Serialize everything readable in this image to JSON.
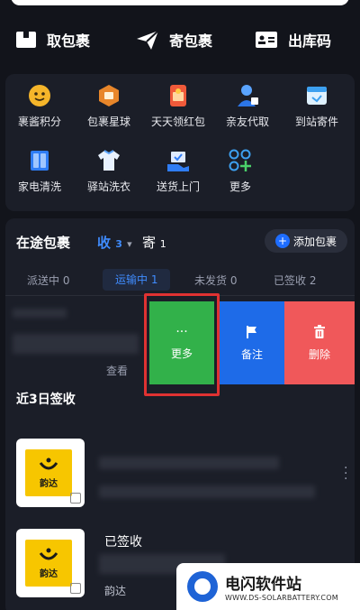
{
  "actions": [
    {
      "label": "取包裹",
      "icon": "package-box-icon"
    },
    {
      "label": "寄包裹",
      "icon": "paper-plane-icon"
    },
    {
      "label": "出库码",
      "icon": "id-card-icon"
    }
  ],
  "services": [
    {
      "label": "裹酱积分",
      "icon": "mascot-points-icon"
    },
    {
      "label": "包裹星球",
      "icon": "planet-package-icon"
    },
    {
      "label": "天天领红包",
      "icon": "red-packet-icon"
    },
    {
      "label": "亲友代取",
      "icon": "person-proxy-icon"
    },
    {
      "label": "到站寄件",
      "icon": "station-send-icon"
    },
    {
      "label": "家电清洗",
      "icon": "appliance-clean-icon"
    },
    {
      "label": "驿站洗衣",
      "icon": "shirt-laundry-icon"
    },
    {
      "label": "送货上门",
      "icon": "home-delivery-icon"
    },
    {
      "label": "更多",
      "icon": "more-grid-plus-icon"
    }
  ],
  "packages": {
    "title": "在途包裹",
    "receive_label": "收",
    "receive_count": "3",
    "send_label": "寄",
    "send_count": "1",
    "add_button": "添加包裹"
  },
  "sub_tabs": [
    {
      "label": "派送中",
      "count": "0"
    },
    {
      "label": "运输中",
      "count": "1"
    },
    {
      "label": "未发货",
      "count": "0"
    },
    {
      "label": "已签收",
      "count": "2"
    }
  ],
  "swipe_actions": {
    "more": "更多",
    "more_icon": "···",
    "note": "备注",
    "delete": "删除"
  },
  "partial_text": {
    "view": "查看"
  },
  "recent": {
    "title": "近3日签收",
    "items": [
      {
        "status": "已签收",
        "carrier": "韵达",
        "logo_text": "韵达"
      },
      {
        "status": "已签收",
        "carrier": "韵达",
        "logo_text": "韵达"
      }
    ]
  },
  "watermark": {
    "name": "电闪软件站",
    "url": "WWW.DS-SOLARBATTERY.COM"
  },
  "colors": {
    "background": "#12141b",
    "panel": "#1b1e28",
    "accent_blue": "#3f8cff",
    "more_green": "#32b14a",
    "note_blue": "#1e6be8",
    "delete_red": "#f0585a",
    "highlight_red": "#e03232",
    "yunda_yellow": "#f7c600"
  }
}
